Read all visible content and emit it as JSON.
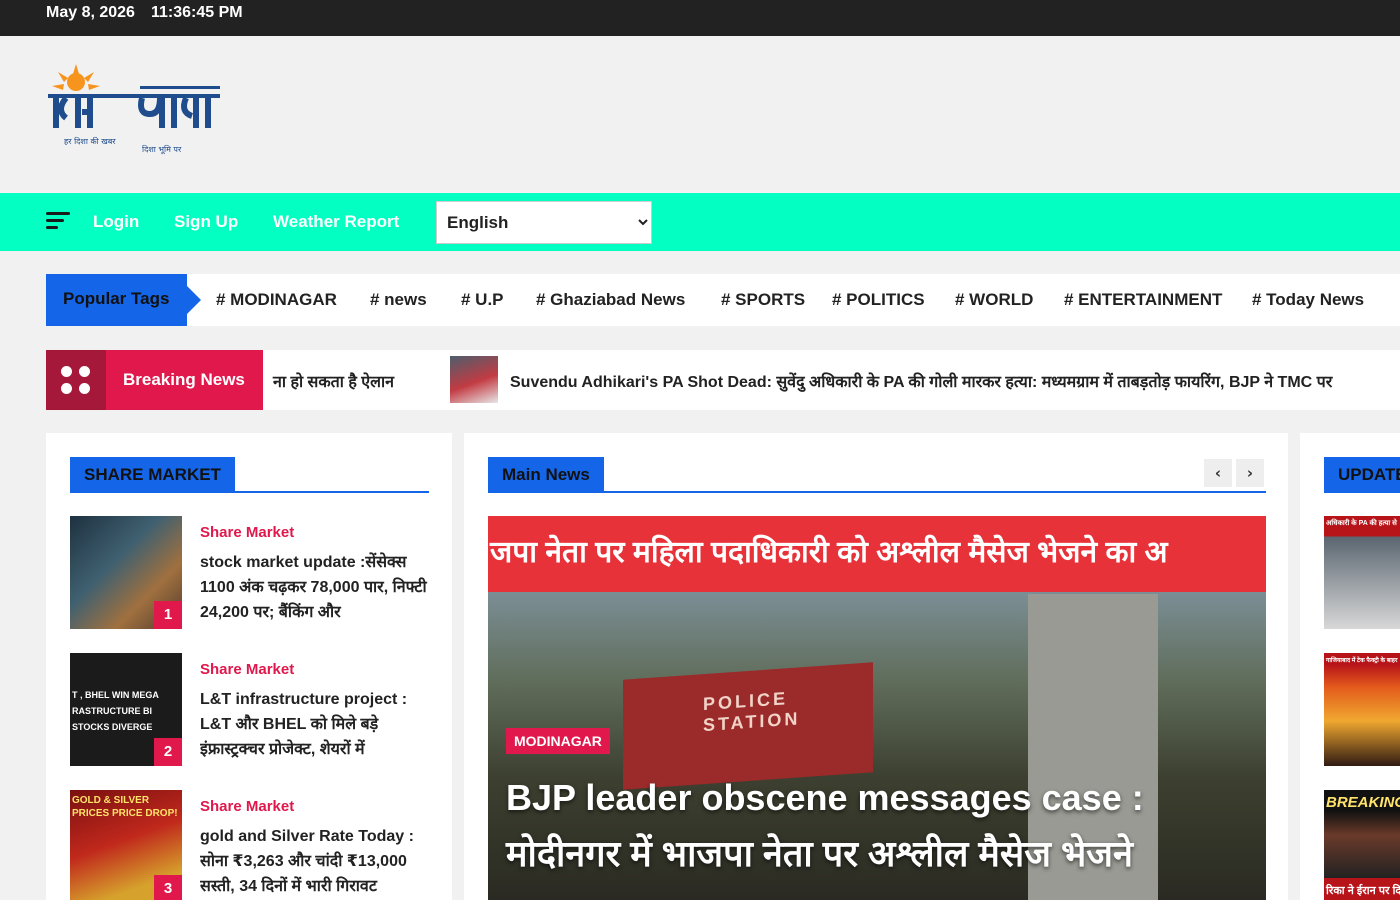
{
  "topbar": {
    "date": "May 8, 2026",
    "time": "11:36:45 PM"
  },
  "logo": {
    "name": "दिशा भूमि",
    "tagline_left": "हर दिशा की खबर",
    "tagline_right": "दिशा भूमि पर"
  },
  "nav": {
    "links": [
      "Login",
      "Sign Up",
      "Weather Report"
    ],
    "language": "English"
  },
  "tags": {
    "label": "Popular Tags",
    "items": [
      "# MODINAGAR",
      "# news",
      "# U.P",
      "# Ghaziabad News",
      "# SPORTS",
      "# POLITICS",
      "# WORLD",
      "# ENTERTAINMENT",
      "# Today News"
    ]
  },
  "breaking": {
    "label": "Breaking News",
    "ticker_prev": "ना हो सकता है ऐलान",
    "ticker_current": "Suvendu Adhikari's PA Shot Dead: सुवेंदु अधिकारी के PA की गोली मारकर हत्या: मध्यमग्राम में ताबड़तोड़ फायरिंग, BJP ने TMC पर"
  },
  "share_market": {
    "heading": "SHARE MARKET",
    "items": [
      {
        "num": "1",
        "category": "Share Market",
        "title": "stock market update :सेंसेक्स 1100 अंक चढ़कर 78,000 पार, निफ्टी 24,200 पर; बैंकिंग और"
      },
      {
        "num": "2",
        "category": "Share Market",
        "title": "L&T infrastructure project : L&T और BHEL को मिले बड़े इंफ्रास्ट्रक्चर प्रोजेक्ट, शेयरों में"
      },
      {
        "num": "3",
        "category": "Share Market",
        "title": "gold and Silver Rate Today : सोना ₹3,263 और चांदी ₹13,000 सस्ती, 34 दिनों में भारी गिरावट"
      }
    ],
    "thumb_texts": [
      "T , BHEL WIN MEGA RASTRUCTURE BI STOCKS DIVERGE",
      "GOLD & SILVER PRICES PRICE DROP!"
    ]
  },
  "main_news": {
    "heading": "Main News",
    "prev": "‹",
    "next": "›",
    "banner": "जपा नेता पर महिला पदाधिकारी को अश्लील मैसेज भेजने का अ",
    "category": "MODINAGAR",
    "title": "BJP leader obscene messages case : मोदीनगर में भाजपा नेता पर अश्लील मैसेज भेजने",
    "sign_text": "POLICE STATION"
  },
  "updates": {
    "heading": "UPDATE",
    "captions": [
      "अधिकारी के PA की हत्या से",
      "गाजियाबाद में टेक फैक्ट्री के बाहर",
      "BREAKING",
      "रिका ने ईरान पर दि"
    ]
  },
  "colors": {
    "accent_blue": "#1565e8",
    "nav_green": "#03ffc2",
    "breaking_red": "#e0184c",
    "topbar": "#222222"
  }
}
